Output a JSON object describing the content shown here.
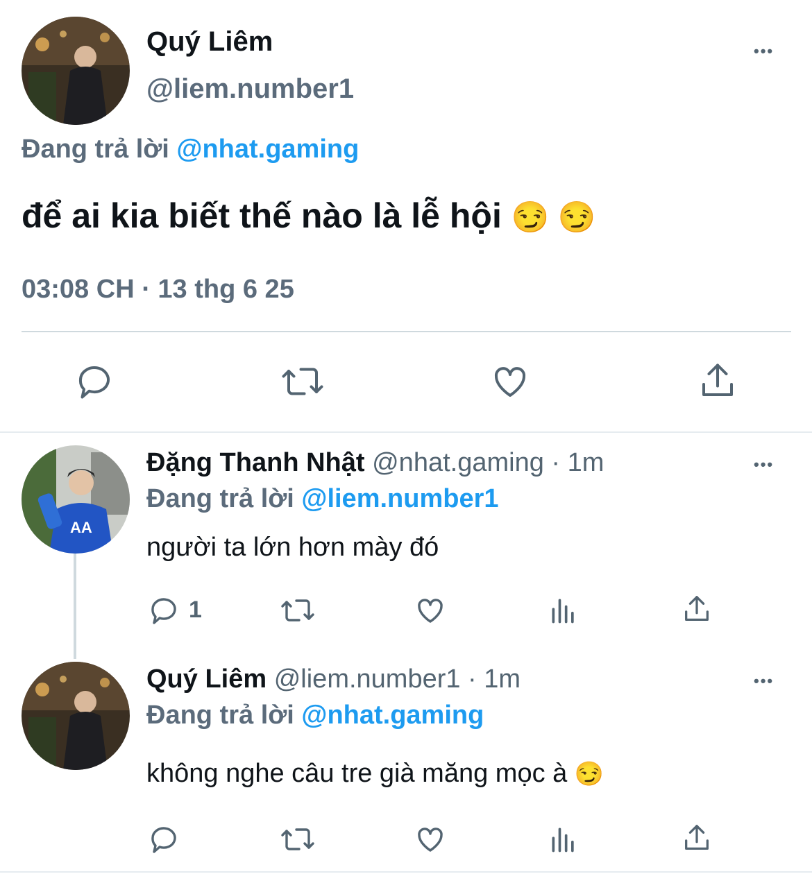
{
  "main_tweet": {
    "display_name": "Quý Liêm",
    "handle": "@liem.number1",
    "replying_prefix": "Đang trả lời",
    "replying_to": "@nhat.gaming",
    "text": "để ai kia biết thế nào là lễ hội",
    "emojis": "😏 😏",
    "timestamp": "03:08 CH · 13 thg 6 25",
    "more": "•••"
  },
  "replies": [
    {
      "display_name": "Đặng Thanh Nhật",
      "handle_time": "@nhat.gaming · 1m",
      "replying_prefix": "Đang trả lời",
      "replying_to": "@liem.number1",
      "text": "người ta lớn hơn mày đó",
      "reply_count": "1",
      "more": "•••"
    },
    {
      "display_name": "Quý Liêm",
      "handle_time": "@liem.number1 · 1m",
      "replying_prefix": "Đang trả lời",
      "replying_to": "@nhat.gaming",
      "text": "không nghe câu tre già măng mọc à",
      "emoji": "😏",
      "more": "•••"
    }
  ],
  "colors": {
    "text": "#0f1419",
    "secondary": "#536471",
    "link": "#1d9bf0",
    "divider": "#cfd9de",
    "thread_line": "#cfd9de"
  },
  "icons": [
    "reply-icon",
    "retweet-icon",
    "like-icon",
    "share-icon",
    "analytics-icon",
    "more-icon"
  ]
}
